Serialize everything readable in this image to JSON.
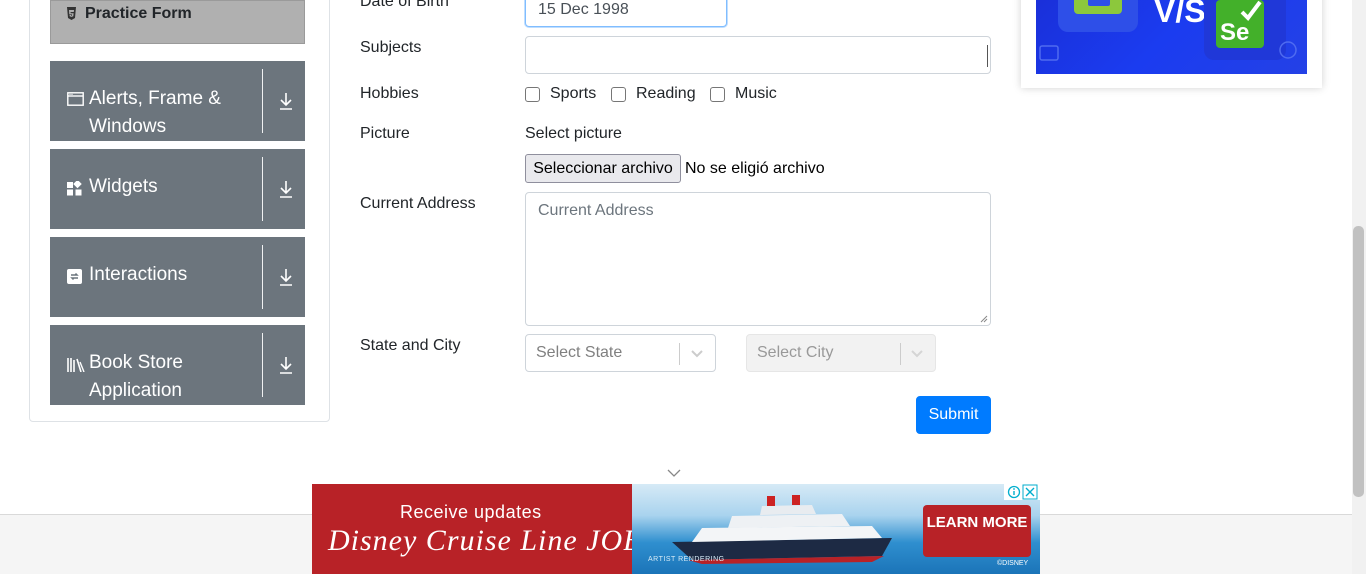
{
  "sidebar": {
    "active_item": {
      "label": "Practice Form",
      "icon": "html5-icon"
    },
    "groups": [
      {
        "label": "Alerts, Frame & Windows",
        "icon": "window-icon"
      },
      {
        "label": "Widgets",
        "icon": "widgets-icon"
      },
      {
        "label": "Interactions",
        "icon": "interactions-icon"
      },
      {
        "label": "Book Store Application",
        "icon": "books-icon"
      }
    ]
  },
  "form": {
    "dob": {
      "label": "Date of Birth",
      "value": "15 Dec 1998"
    },
    "subjects": {
      "label": "Subjects",
      "value": ""
    },
    "hobbies": {
      "label": "Hobbies",
      "options": [
        "Sports",
        "Reading",
        "Music"
      ]
    },
    "picture": {
      "label": "Picture",
      "select_label": "Select picture",
      "button": "Seleccionar archivo",
      "status": "No se eligió archivo"
    },
    "address": {
      "label": "Current Address",
      "placeholder": "Current Address"
    },
    "state_city": {
      "label": "State and City",
      "state_placeholder": "Select State",
      "city_placeholder": "Select City"
    },
    "submit": "Submit"
  },
  "footer_ad": {
    "line1": "Receive updates",
    "line2": "Disney Cruise Line JOBS",
    "cta": "LEARN MORE",
    "artist": "ARTIST RENDERING",
    "copyright": "©DISNEY"
  },
  "colors": {
    "sidebar_group": "#6c757d",
    "active_item": "#b0b0b0",
    "primary": "#007bff",
    "ad_red": "#b82227"
  }
}
